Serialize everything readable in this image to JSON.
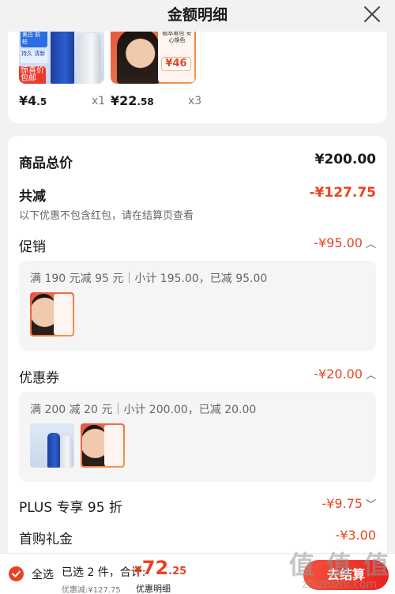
{
  "header": {
    "title": "金额明细"
  },
  "products": [
    {
      "price_int": "¥4",
      "price_dec": ".5",
      "qty": "x1",
      "img_text": {
        "a": "美白 防蛀",
        "b": "持久 清新",
        "c": "惊喜价 包邮"
      }
    },
    {
      "price_int": "¥22",
      "price_dec": ".58",
      "qty": "x3",
      "img_text": {
        "line": "植萃着色 安心焕色",
        "price": "¥46"
      }
    }
  ],
  "summary": {
    "total_label": "商品总价",
    "total_value": "¥200.00",
    "reduce_label": "共减",
    "reduce_value": "-¥127.75",
    "reduce_note": "以下优惠不包含红包，请在结算页查看"
  },
  "promotion": {
    "label": "促销",
    "value": "-¥95.00",
    "rule": "满 190 元减 95 元｜小计 195.00，已减 95.00"
  },
  "coupon": {
    "label": "优惠券",
    "value": "-¥20.00",
    "rule": "满 200 减 20 元｜小计 200.00，已减 20.00"
  },
  "plus": {
    "label": "PLUS 专享 95 折",
    "value": "-¥9.75"
  },
  "first_gift": {
    "label": "首购礼金",
    "value": "-¥3.00"
  },
  "bottom_bar": {
    "select_all": "全选",
    "picked": "已选 2 件，合计:",
    "total_currency": "¥",
    "total_int": "72",
    "total_dec": ".25",
    "discount_text": "优惠减:¥127.75",
    "detail_link": "优惠明细",
    "checkout": "去结算"
  },
  "watermark": {
    "big": "值 值 值",
    "small": "zhizhizhi.com"
  },
  "colors": {
    "accent": "#e8431f",
    "background": "#f2f2f2"
  }
}
